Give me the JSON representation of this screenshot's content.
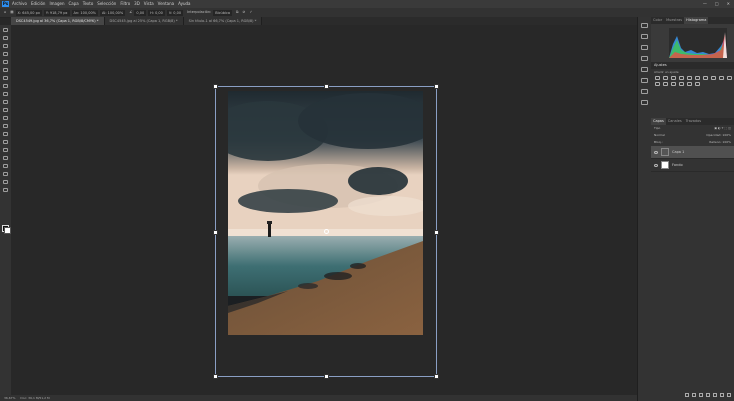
{
  "menubar": {
    "logo": "Ps",
    "items": [
      "Archivo",
      "Edición",
      "Imagen",
      "Capa",
      "Texto",
      "Selección",
      "Filtro",
      "3D",
      "Vista",
      "Ventana",
      "Ayuda"
    ],
    "window_controls": [
      "—",
      "□",
      "✕"
    ]
  },
  "options": {
    "x": "X: 645,00 px",
    "y": "Y: 918,79 px",
    "w": "An: 100,00%",
    "h": "Al: 100,00%",
    "angle": "0,00",
    "hskew": "H: 0,00",
    "vskew": "V: 0,00",
    "interp_label": "Interpolación:",
    "interp": "Bicúbica"
  },
  "tabs": [
    {
      "label": "DSC4549.jpg al 36,7% (Capa 1, RGB/8/CMYK) *",
      "active": true
    },
    {
      "label": "DSC4545.jpg al 25% (Capa 1, RGB/8) *",
      "active": false
    },
    {
      "label": "Sin título-1 al 66,7% (Capa 1, RGB/8) *",
      "active": false
    }
  ],
  "statusbar": {
    "zoom": "36,67%",
    "doc": "Doc: 36,1 M/51,2 M"
  },
  "panels": {
    "top_tabs": [
      "Color",
      "Muestras",
      "Histograma"
    ],
    "adjustments_title": "Ajustes",
    "adjustments_sub": "Añadir un ajuste",
    "layers_tabs": [
      "Capas",
      "Canales",
      "Trazados"
    ],
    "filter_label": "Tipo",
    "blend_mode": "Normal",
    "opacity": "Opacidad: 100%",
    "lock": "Bloq.:",
    "fill": "Relleno: 100%",
    "layers": [
      {
        "name": "Capa 1",
        "selected": true
      },
      {
        "name": "Fondo",
        "selected": false
      }
    ]
  },
  "colors": {
    "accent": "#2d8ef0",
    "canvas_bg": "#282828",
    "selection": "#8a9fc4"
  }
}
